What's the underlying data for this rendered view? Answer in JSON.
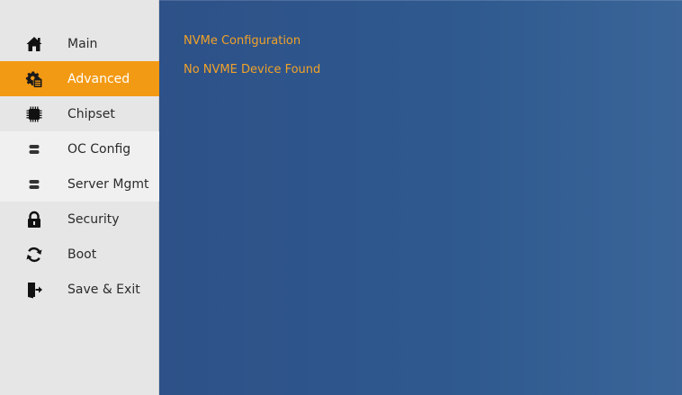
{
  "sidebar": {
    "items": [
      {
        "label": "Main",
        "icon": "home-icon"
      },
      {
        "label": "Advanced",
        "icon": "advanced-settings-icon",
        "active": true
      },
      {
        "label": "Chipset",
        "icon": "chip-icon"
      },
      {
        "label": "OC Config",
        "icon": "toggle-icon"
      },
      {
        "label": "Server Mgmt",
        "icon": "toggle-icon"
      },
      {
        "label": "Security",
        "icon": "lock-icon"
      },
      {
        "label": "Boot",
        "icon": "refresh-icon"
      },
      {
        "label": "Save & Exit",
        "icon": "exit-door-icon"
      }
    ]
  },
  "main": {
    "title": "NVMe Configuration",
    "message": "No NVME Device Found"
  },
  "colors": {
    "sidebar_bg": "#e6e6e6",
    "active_item_bg": "#f39a14",
    "main_bg": "#2f5a8f",
    "accent_text": "#f2a228",
    "item_text": "#2b2b2b"
  }
}
